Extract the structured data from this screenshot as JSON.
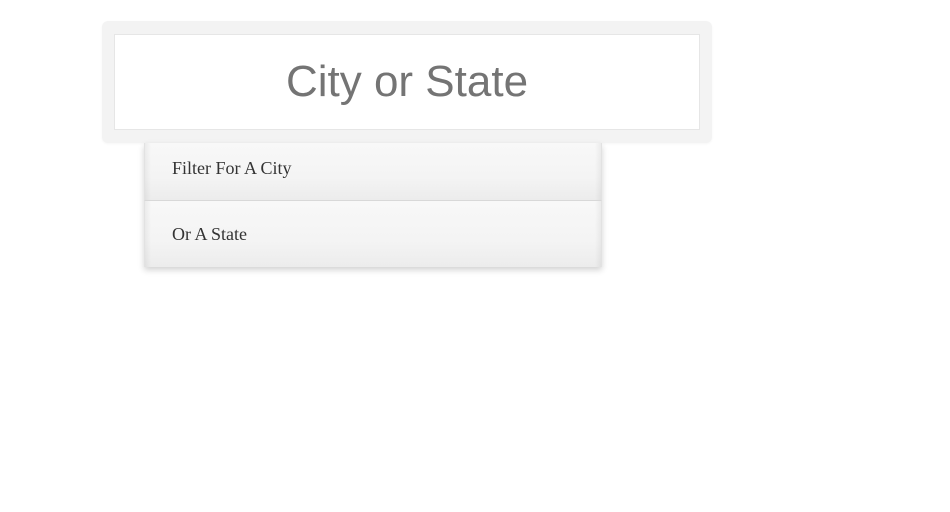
{
  "search": {
    "placeholder": "City or State",
    "value": ""
  },
  "suggestions": {
    "items": [
      {
        "label": "Filter For A City"
      },
      {
        "label": "Or A State"
      }
    ]
  }
}
